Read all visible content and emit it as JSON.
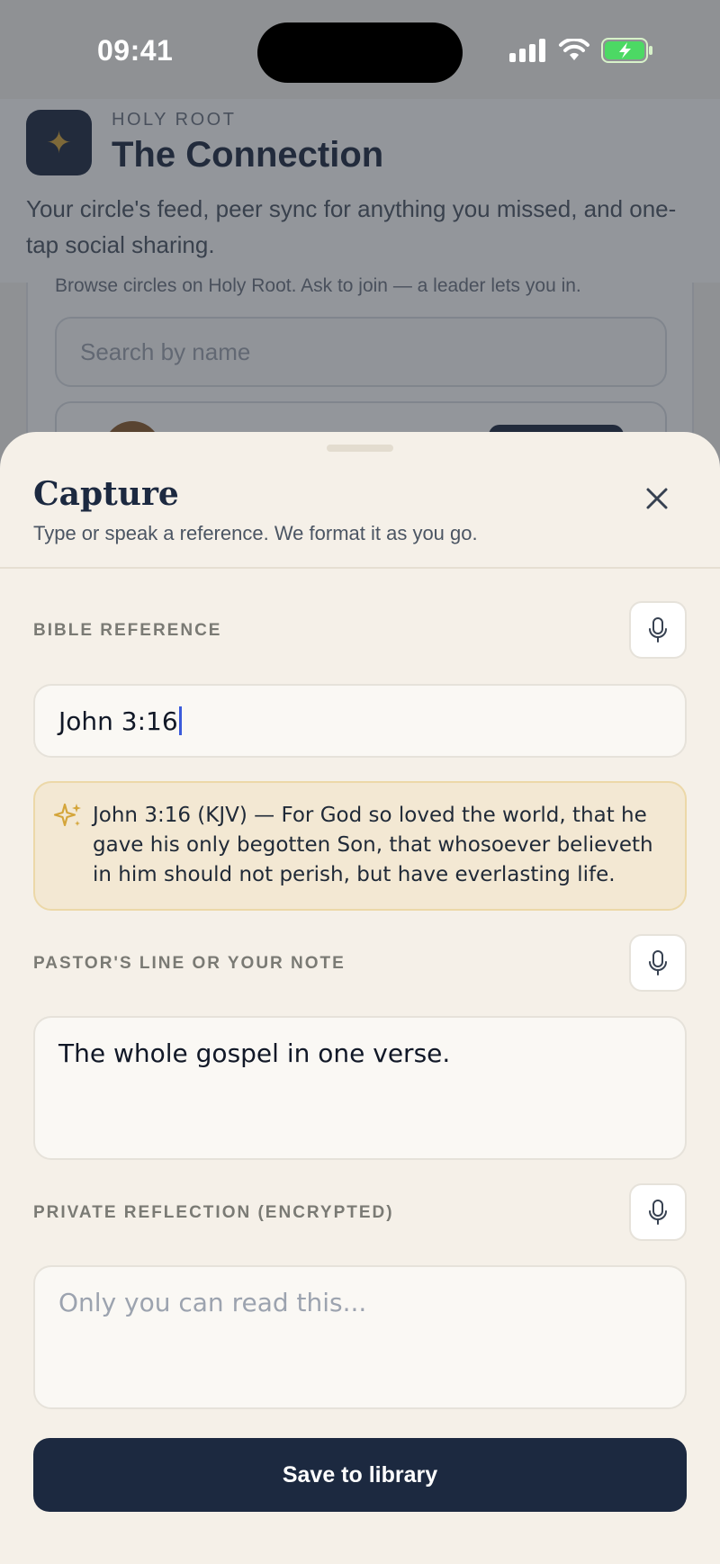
{
  "status_bar": {
    "time": "09:41"
  },
  "background": {
    "eyebrow": "HOLY ROOT",
    "title": "The Connection",
    "description": "Your circle's feed, peer sync for anything you missed, and one-tap social sharing.",
    "browse_text": "Browse circles on Holy Root. Ask to join — a leader lets you in.",
    "search_placeholder": "Search by name"
  },
  "sheet": {
    "title": "Capture",
    "subtitle": "Type or speak a reference. We format it as you go.",
    "reference": {
      "label": "BIBLE REFERENCE",
      "value": "John 3:16"
    },
    "suggestion": {
      "text": "John 3:16 (KJV) — For God so loved the world, that he gave his only begotten Son, that whosoever believeth in him should not perish, but have everlasting life."
    },
    "note": {
      "label": "PASTOR'S LINE OR YOUR NOTE",
      "value": "The whole gospel in one verse."
    },
    "reflection": {
      "label": "PRIVATE REFLECTION (ENCRYPTED)",
      "placeholder": "Only you can read this..."
    },
    "save_label": "Save to library"
  },
  "colors": {
    "navy": "#1c2940",
    "gold": "#d4a53a",
    "sheet_bg": "#f5f0e8",
    "suggestion_bg": "#f3e8d3",
    "caret": "#3b5bdb"
  }
}
